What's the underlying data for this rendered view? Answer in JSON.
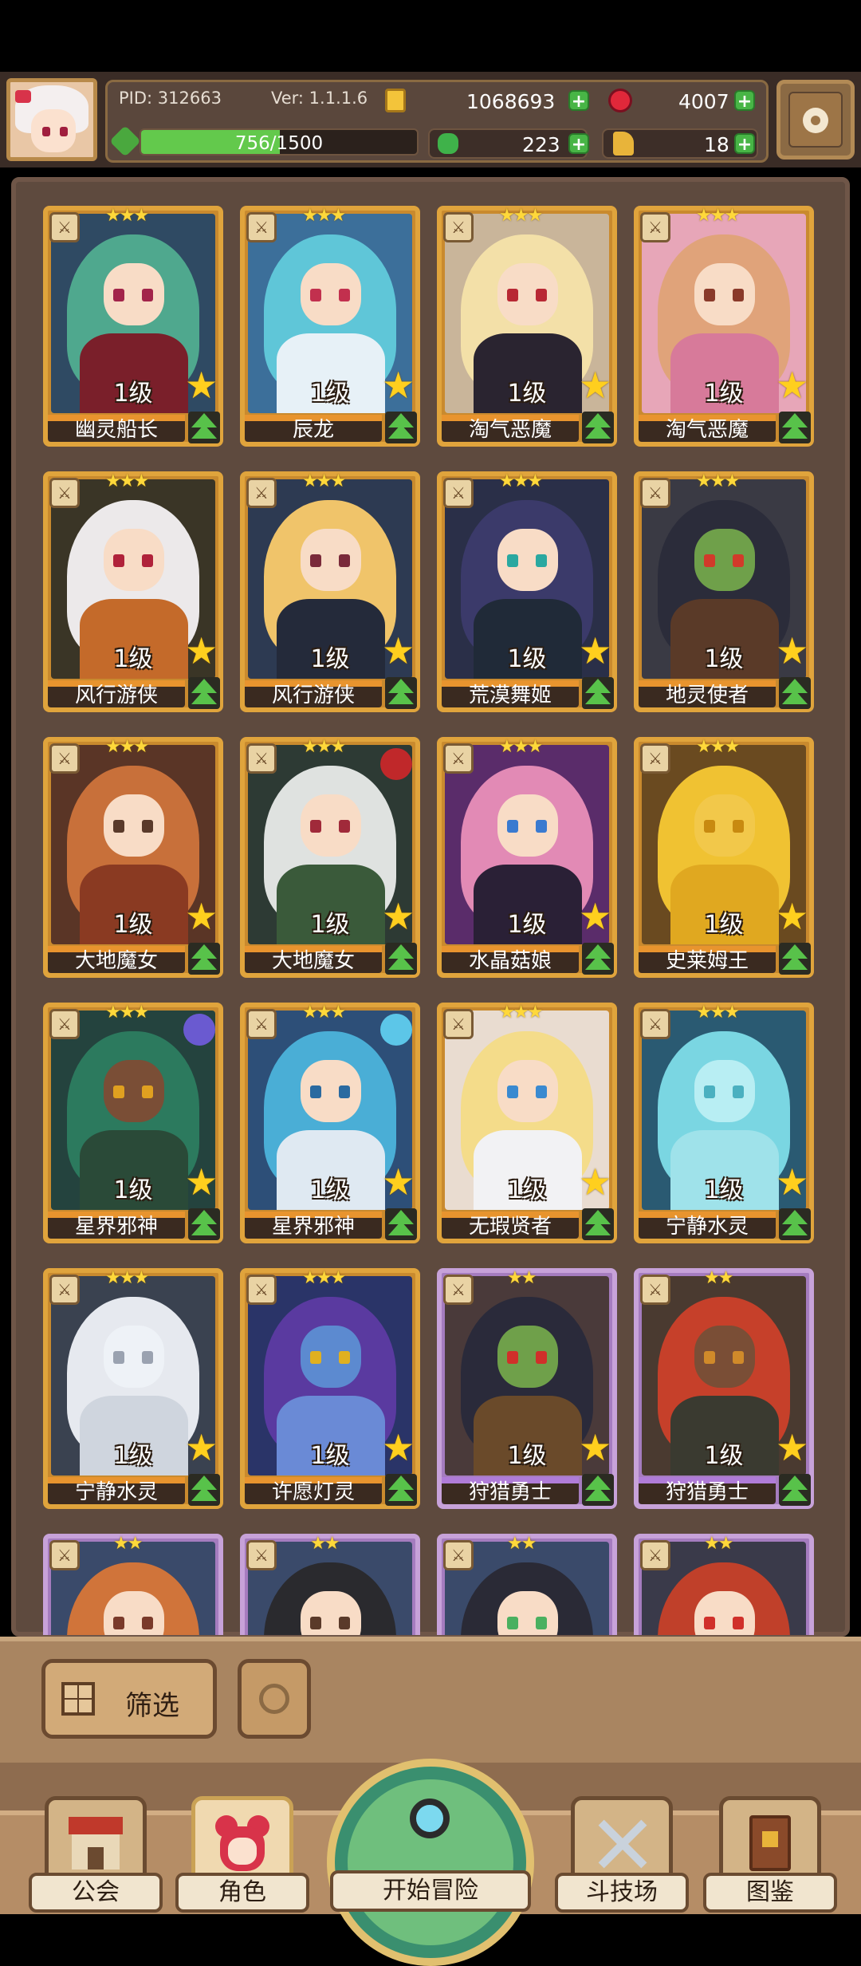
{
  "header": {
    "pid_label": "PID: 312663",
    "version_label": "Ver: 1.1.1.6",
    "gold": "1068693",
    "gems": "4007",
    "xp_text": "756/1500",
    "xp_progress": 0.504,
    "clover": "223",
    "horn": "18"
  },
  "cards": [
    {
      "name": "幽灵船长",
      "level": "1级",
      "frame": "gold",
      "hair": "#4fa88e",
      "skin": "light",
      "eye": "#a2244a",
      "body": "#7a1f2a",
      "bg": "#2f4a63"
    },
    {
      "name": "辰龙",
      "level": "1级",
      "frame": "gold",
      "hair": "#5fc6d8",
      "skin": "light",
      "eye": "#c2304e",
      "body": "#e7f1f7",
      "bg": "#3c6f9a"
    },
    {
      "name": "淘气恶魔",
      "level": "1级",
      "frame": "gold",
      "hair": "#f3e0a8",
      "skin": "light",
      "eye": "#b82834",
      "body": "#2a2430",
      "bg": "#c9b59a"
    },
    {
      "name": "淘气恶魔",
      "level": "1级",
      "frame": "gold",
      "hair": "#e0a37a",
      "skin": "light",
      "eye": "#8a3a2a",
      "body": "#d77a9a",
      "bg": "#e7a6b8"
    },
    {
      "name": "风行游侠",
      "level": "1级",
      "frame": "gold",
      "hair": "#ece9ea",
      "skin": "light",
      "eye": "#b0223a",
      "body": "#c46a2a",
      "bg": "#3a3526"
    },
    {
      "name": "风行游侠",
      "level": "1级",
      "frame": "gold",
      "hair": "#f0c46a",
      "skin": "light",
      "eye": "#7a2a3a",
      "body": "#242a3a",
      "bg": "#2d3a52"
    },
    {
      "name": "荒漠舞姬",
      "level": "1级",
      "frame": "gold",
      "hair": "#3b3a6a",
      "skin": "light",
      "eye": "#2aa8a0",
      "body": "#202a38",
      "bg": "#2a2f48"
    },
    {
      "name": "地灵使者",
      "level": "1级",
      "frame": "gold",
      "hair": "#2b2c3a",
      "skin": "green",
      "eye": "#d23a2a",
      "body": "#5a3a28",
      "bg": "#3a3a44"
    },
    {
      "name": "大地魔女",
      "level": "1级",
      "frame": "gold",
      "hair": "#c8703a",
      "skin": "light",
      "eye": "#5a3a2a",
      "body": "#8a3a22",
      "bg": "#5a3526"
    },
    {
      "name": "大地魔女",
      "level": "1级",
      "frame": "gold",
      "hair": "#dfe2e0",
      "skin": "light",
      "eye": "#a02a3a",
      "body": "#3a5a3a",
      "bg": "#2d3a34"
    },
    {
      "name": "水晶菇娘",
      "level": "1级",
      "frame": "gold",
      "hair": "#e28ab5",
      "skin": "light",
      "eye": "#3a7ad0",
      "body": "#2a2036",
      "bg": "#5a2c6a"
    },
    {
      "name": "史莱姆王",
      "level": "1级",
      "frame": "gold",
      "hair": "#f0c232",
      "skin": "gold",
      "eye": "#c88a10",
      "body": "#e0a820",
      "bg": "#6a4a20"
    },
    {
      "name": "星界邪神",
      "level": "1级",
      "frame": "gold",
      "hair": "#2c7a5e",
      "skin": "dark",
      "eye": "#e0a020",
      "body": "#2a4a38",
      "bg": "#24433e"
    },
    {
      "name": "星界邪神",
      "level": "1级",
      "frame": "gold",
      "hair": "#4aaed6",
      "skin": "light",
      "eye": "#2a6aa0",
      "body": "#dfe9f2",
      "bg": "#2d4f78"
    },
    {
      "name": "无瑕贤者",
      "level": "1级",
      "frame": "gold",
      "hair": "#f4dc8a",
      "skin": "light",
      "eye": "#3a8ad0",
      "body": "#f2f2f4",
      "bg": "#e9dcd0"
    },
    {
      "name": "宁静水灵",
      "level": "1级",
      "frame": "gold",
      "hair": "#7ad6e2",
      "skin": "aqua",
      "eye": "#4ab0c0",
      "body": "#9fe2ea",
      "bg": "#2a5a72"
    },
    {
      "name": "宁静水灵",
      "level": "1级",
      "frame": "gold",
      "hair": "#e6e9ef",
      "skin": "ghost",
      "eye": "#9aa2b0",
      "body": "#cfd5de",
      "bg": "#3a4250"
    },
    {
      "name": "许愿灯灵",
      "level": "1级",
      "frame": "gold",
      "hair": "#5a3aa0",
      "skin": "blue",
      "eye": "#e0b020",
      "body": "#6a8ad6",
      "bg": "#2a3468"
    },
    {
      "name": "狩猎勇士",
      "level": "1级",
      "frame": "purple",
      "hair": "#2a2a3a",
      "skin": "green",
      "eye": "#d0302a",
      "body": "#6a4a2a",
      "bg": "#4a3a3a"
    },
    {
      "name": "狩猎勇士",
      "level": "1级",
      "frame": "purple",
      "hair": "#c6402a",
      "skin": "dark",
      "eye": "#d08a2a",
      "body": "#3a3a30",
      "bg": "#4a3a30"
    },
    {
      "name": "",
      "level": "",
      "frame": "purple",
      "hair": "#d0743a",
      "skin": "light",
      "eye": "#7a3a2a",
      "body": "#b06a3a",
      "bg": "#3a4a6a"
    },
    {
      "name": "",
      "level": "",
      "frame": "purple",
      "hair": "#2a2a2e",
      "skin": "light",
      "eye": "#5a3a2a",
      "body": "#e2e2e6",
      "bg": "#3a4a6a"
    },
    {
      "name": "",
      "level": "",
      "frame": "purple",
      "hair": "#2a2a36",
      "skin": "light",
      "eye": "#4ab060",
      "body": "#8a8a9a",
      "bg": "#3a4a6a"
    },
    {
      "name": "",
      "level": "",
      "frame": "purple",
      "hair": "#c0402a",
      "skin": "light",
      "eye": "#d0302a",
      "body": "#8a2a2a",
      "bg": "#3a3a4a"
    }
  ],
  "toolbar": {
    "filter_label": "筛选"
  },
  "nav": {
    "guild": "公会",
    "character": "角色",
    "adventure": "开始冒险",
    "arena": "斗技场",
    "codex": "图鉴"
  },
  "colors": {
    "frame_gold": "#e0a43c",
    "frame_purple": "#c7a2d9",
    "plus_green": "#48b546",
    "panel_brown": "#5e4a3e"
  }
}
